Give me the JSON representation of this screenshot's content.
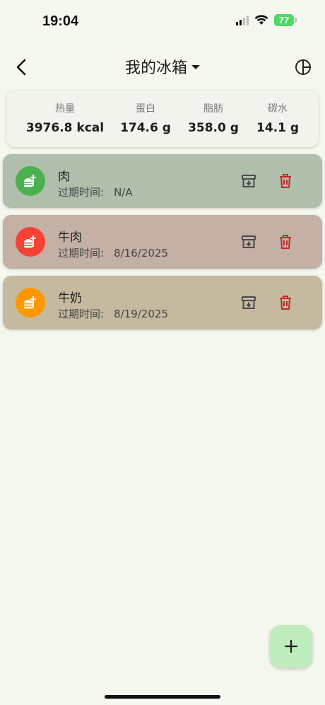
{
  "status": {
    "time": "19:04",
    "battery": "77"
  },
  "header": {
    "title": "我的冰箱",
    "back_icon": "chevron-left-icon",
    "chart_icon": "pie-chart-icon"
  },
  "summary": {
    "calories": {
      "label": "热量",
      "value": "3976.8 kcal"
    },
    "protein": {
      "label": "蛋白",
      "value": "174.6 g"
    },
    "fat": {
      "label": "脂肪",
      "value": "358.0 g"
    },
    "carbs": {
      "label": "碳水",
      "value": "14.1 g"
    }
  },
  "items": [
    {
      "name": "肉",
      "expiry_label": "过期时间:",
      "expiry": "N/A",
      "avatar_color": "#4caf50",
      "bg_color": "#b0bfac"
    },
    {
      "name": "牛肉",
      "expiry_label": "过期时间:",
      "expiry": "8/16/2025",
      "avatar_color": "#f44336",
      "bg_color": "#c5b0a6"
    },
    {
      "name": "牛奶",
      "expiry_label": "过期时间:",
      "expiry": "8/19/2025",
      "avatar_color": "#ff9800",
      "bg_color": "#c5b9a0"
    }
  ],
  "colors": {
    "background": "#f5f8ee",
    "delete": "#c62828",
    "archive": "#4a4a4a",
    "fab": "#c0edbe"
  },
  "fab": {
    "icon": "plus-icon"
  }
}
